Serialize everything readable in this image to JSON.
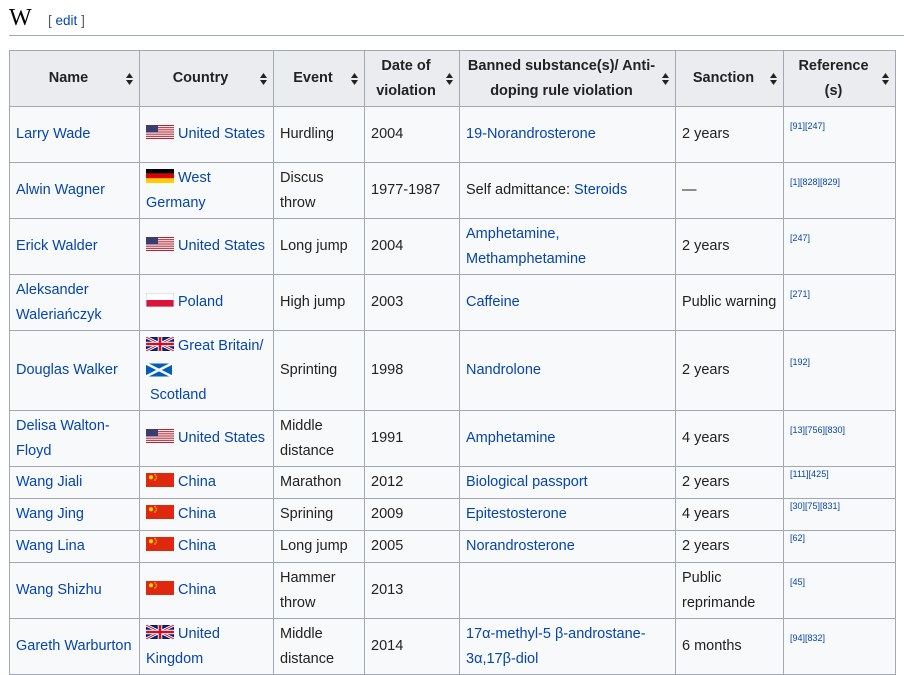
{
  "section": {
    "title": "W",
    "edit_open": "[",
    "edit_label": "edit",
    "edit_close": "]"
  },
  "columns": [
    "Name",
    "Country",
    "Event",
    "Date of violation",
    "Banned substance(s)/ Anti-doping rule violation",
    "Sanction",
    "Reference (s)"
  ],
  "rows": [
    {
      "name": "Larry Wade",
      "flags": [
        "us"
      ],
      "country": "United States",
      "event": "Hurdling",
      "date": "2004",
      "substance": [
        {
          "text": "19-Norandrosterone",
          "kind": "link"
        }
      ],
      "sanction": "2 years",
      "refs": "[91][247]"
    },
    {
      "name": "Alwin Wagner",
      "flags": [
        "de"
      ],
      "country": "West Germany",
      "event": "Discus throw",
      "date": "1977-1987",
      "substance": [
        {
          "text": "Self admittance: ",
          "kind": "plain"
        },
        {
          "text": "Steroids",
          "kind": "link"
        }
      ],
      "sanction": "—",
      "refs": "[1][828][829]"
    },
    {
      "name": "Erick Walder",
      "flags": [
        "us"
      ],
      "country": "United States",
      "event": "Long jump",
      "date": "2004",
      "substance": [
        {
          "text": "Amphetamine, Methamphetamine",
          "kind": "link"
        }
      ],
      "sanction": "2 years",
      "refs": "[247]"
    },
    {
      "name": "Aleksander Waleriańczyk",
      "flags": [
        "pl"
      ],
      "country": "Poland",
      "event": "High jump",
      "date": "2003",
      "substance": [
        {
          "text": "Caffeine",
          "kind": "link"
        }
      ],
      "sanction": "Public warning",
      "refs": "[271]"
    },
    {
      "name": "Douglas Walker",
      "flags": [
        "gb",
        "sco"
      ],
      "country": "Great Britain/ Scotland",
      "event": "Sprinting",
      "date": "1998",
      "substance": [
        {
          "text": "Nandrolone",
          "kind": "link"
        }
      ],
      "sanction": "2 years",
      "refs": "[192]"
    },
    {
      "name": "Delisa Walton-Floyd",
      "flags": [
        "us"
      ],
      "country": "United States",
      "event": "Middle distance",
      "date": "1991",
      "substance": [
        {
          "text": "Amphetamine",
          "kind": "link"
        }
      ],
      "sanction": "4 years",
      "refs": "[13][756][830]"
    },
    {
      "name": "Wang Jiali",
      "flags": [
        "cn"
      ],
      "country": "China",
      "event": "Marathon",
      "date": "2012",
      "substance": [
        {
          "text": "Biological passport",
          "kind": "link"
        }
      ],
      "sanction": "2 years",
      "refs": "[111][425]"
    },
    {
      "name": "Wang Jing",
      "flags": [
        "cn"
      ],
      "country": "China",
      "event": "Sprining",
      "date": "2009",
      "substance": [
        {
          "text": "Epitestosterone",
          "kind": "link"
        }
      ],
      "sanction": "4 years",
      "refs": "[30][75][831]"
    },
    {
      "name": "Wang Lina",
      "flags": [
        "cn"
      ],
      "country": "China",
      "event": "Long jump",
      "date": "2005",
      "substance": [
        {
          "text": "Norandrosterone",
          "kind": "link"
        }
      ],
      "sanction": "2 years",
      "refs": "[62]"
    },
    {
      "name": "Wang Shizhu",
      "flags": [
        "cn"
      ],
      "country": "China",
      "event": "Hammer throw",
      "date": "2013",
      "substance": [],
      "sanction": "Public reprimande",
      "refs": "[45]"
    },
    {
      "name": "Gareth Warburton",
      "flags": [
        "gb"
      ],
      "country": "United Kingdom",
      "event": "Middle distance",
      "date": "2014",
      "substance": [
        {
          "text": "17α-methyl-5 β-androstane-3α,17β-diol",
          "kind": "redlink"
        }
      ],
      "sanction": "6 months",
      "refs": "[94][832]"
    }
  ],
  "colors": {
    "link": "#0645ad",
    "redlink": "#ba0000",
    "header_bg": "#eaecf0",
    "cell_bg": "#f8f9fa",
    "border": "#a2a9b1"
  }
}
